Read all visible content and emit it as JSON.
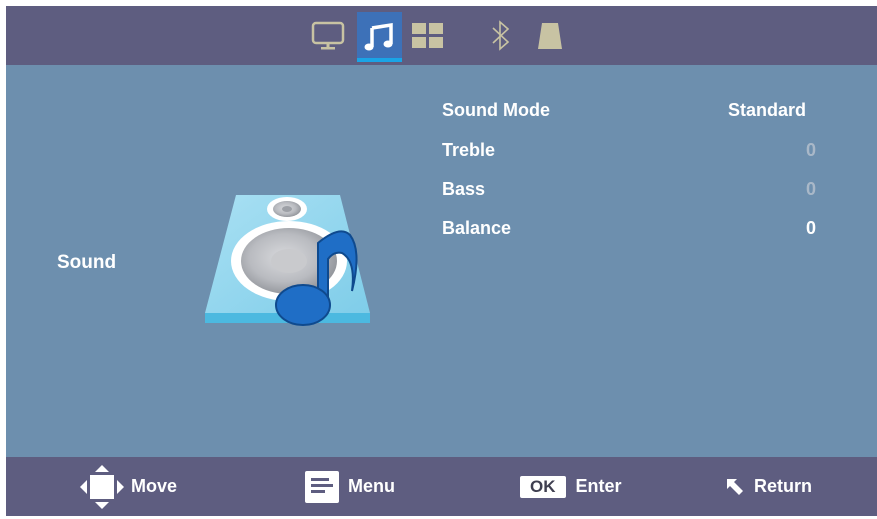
{
  "tabs": {
    "items": [
      {
        "name": "picture",
        "icon": "monitor-icon"
      },
      {
        "name": "sound",
        "icon": "music-note-icon",
        "active": true
      },
      {
        "name": "setup",
        "icon": "grid-icon"
      },
      {
        "name": "bluetooth",
        "icon": "bluetooth-icon"
      },
      {
        "name": "keystone",
        "icon": "keystone-icon"
      }
    ]
  },
  "section": {
    "label": "Sound",
    "illustration": "speaker-music-icon"
  },
  "menu": {
    "items": [
      {
        "label": "Sound Mode",
        "value": "Standard"
      },
      {
        "label": "Treble",
        "value": "0"
      },
      {
        "label": "Bass",
        "value": "0"
      },
      {
        "label": "Balance",
        "value": "0"
      }
    ]
  },
  "footer": {
    "move": "Move",
    "menu": "Menu",
    "ok_badge": "OK",
    "enter": "Enter",
    "return": "Return"
  },
  "colors": {
    "bar": "#5e5d80",
    "panel": "#6d8fae",
    "active_tab": "#3d71b8",
    "accent": "#1aa4e6"
  }
}
